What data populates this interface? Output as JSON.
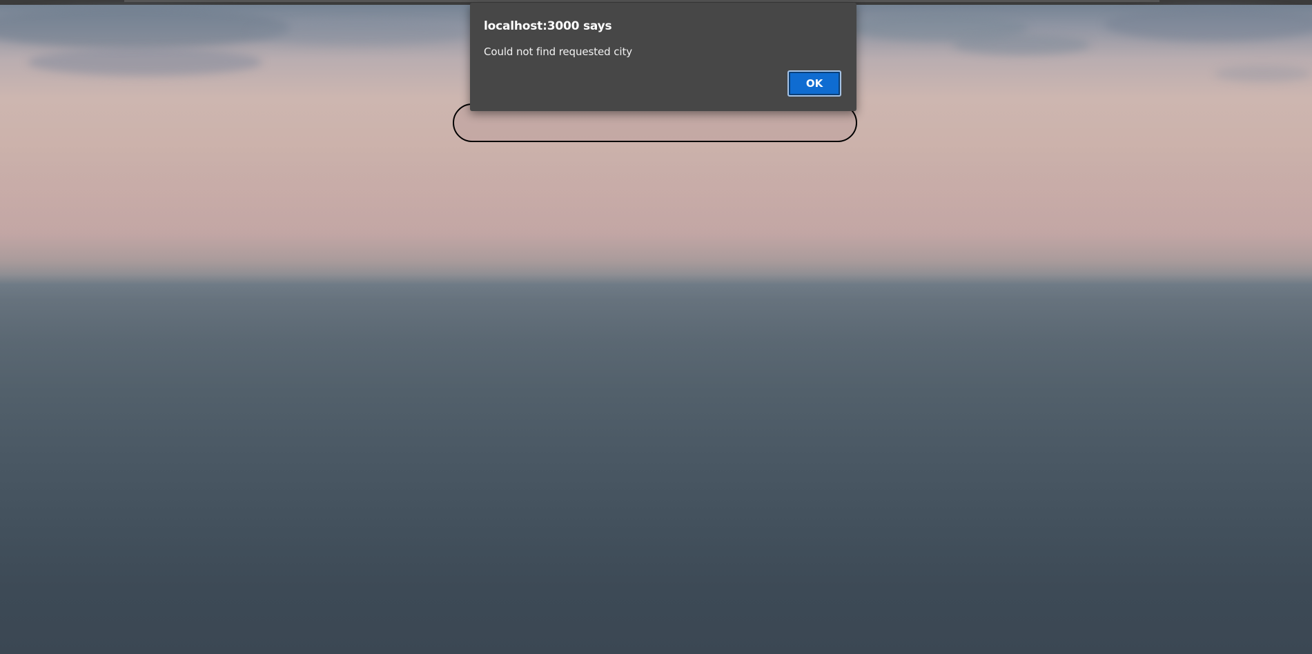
{
  "alert": {
    "title": "localhost:3000 says",
    "message": "Could not find requested city",
    "ok_label": "OK"
  },
  "search": {
    "value": "",
    "placeholder": ""
  },
  "colors": {
    "dialog_background": "#474747",
    "ok_button": "#0f6cd1",
    "input_border": "#000000"
  }
}
